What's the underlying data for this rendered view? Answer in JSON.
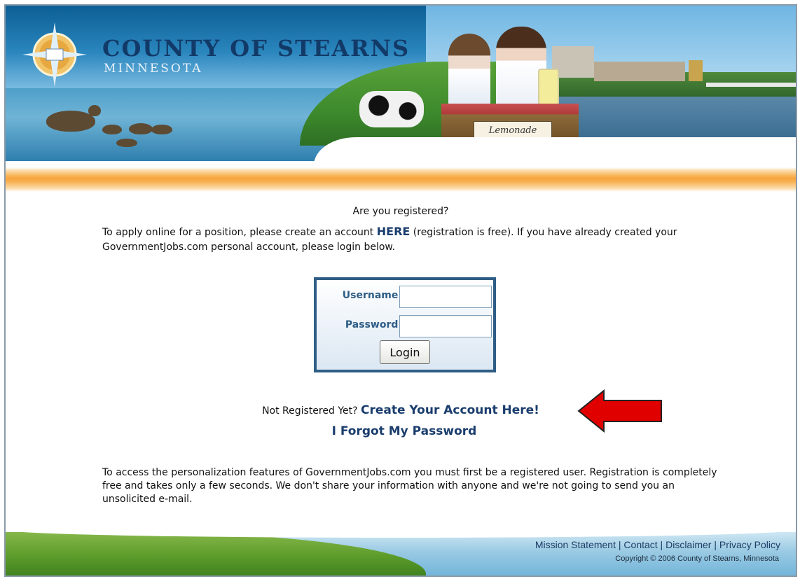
{
  "header": {
    "title": "COUNTY OF STEARNS",
    "subtitle": "MINNESOTA",
    "sign_text": "Lemonade"
  },
  "main": {
    "question": "Are you registered?",
    "intro_prefix": "To apply online for a position, please create an account ",
    "intro_link": "HERE",
    "intro_suffix": " (registration is free). If you have already created your GovernmentJobs.com personal account, please login below.",
    "login": {
      "username_label": "Username:",
      "password_label": "Password:",
      "username_value": "",
      "password_value": "",
      "button_label": "Login"
    },
    "not_registered_text": "Not Registered Yet? ",
    "create_account_link": "Create Your Account Here!",
    "forgot_password_link": "I Forgot My Password",
    "outro": "To access the personalization features of GovernmentJobs.com you must first be a registered user. Registration is completely free and takes only a few seconds. We don't share your information with anyone and we're not going to send you an unsolicited e-mail."
  },
  "footer": {
    "links": [
      "Mission Statement",
      "Contact",
      "Disclaimer",
      "Privacy Policy"
    ],
    "separator": " | ",
    "copyright": "Copyright © 2006 County of Stearns, Minnesota"
  },
  "colors": {
    "accent": "#1a3d6d",
    "login_border": "#2e5d86",
    "arrow": "#e00000",
    "orange_bar": "#f7a53c"
  },
  "icons": [
    "compass-logo-icon",
    "red-arrow-icon"
  ]
}
